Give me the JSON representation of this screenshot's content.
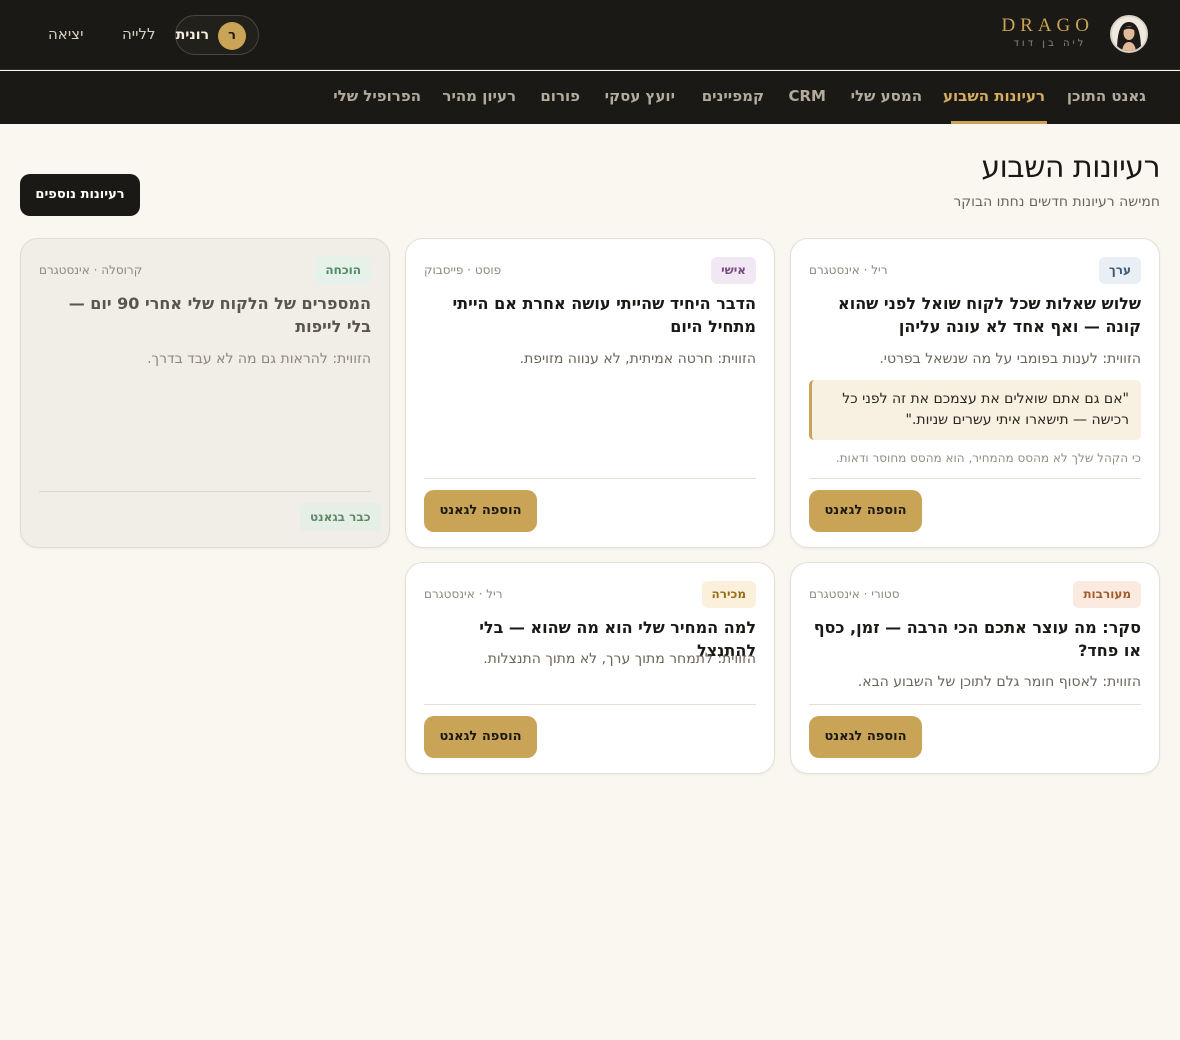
{
  "brand": {
    "name": "DRAGO",
    "subtitle": "ליה בן דוד"
  },
  "user": {
    "initial": "ר",
    "name": "רונית"
  },
  "topbar": {
    "night": "ללייה",
    "logout": "יציאה"
  },
  "nav": {
    "tabs": [
      {
        "label": "גאנט התוכן"
      },
      {
        "label": "רעיונות השבוע"
      },
      {
        "label": "המסע שלי"
      },
      {
        "label": "CRM"
      },
      {
        "label": "קמפיינים"
      },
      {
        "label": "יועץ עסקי"
      },
      {
        "label": "פורום"
      },
      {
        "label": "רעיון מהיר"
      },
      {
        "label": "הפרופיל שלי"
      }
    ],
    "active": "רעיונות השבוע"
  },
  "header": {
    "title": "רעיונות השבוע",
    "subtitle": "חמישה רעיונות חדשים נחתו הבוקר",
    "more_button": "רעיונות נוספים"
  },
  "cards": [
    {
      "tag": "ערך",
      "meta": "ריל · אינסטגרם",
      "title": "שלוש שאלות שכל לקוח שואל לפני שהוא קונה — ואף אחד לא עונה עליהן",
      "angle": "הזווית: לענות בפומבי על מה שנשאל בפרטי.",
      "quote": "\"אם גם אתם שואלים את עצמכם את זה לפני כל רכישה — תישארו איתי עשרים שניות.\"",
      "note": "כי הקהל שלך לא מהסס מהמחיר, הוא מהסס מחוסר ודאות.",
      "button": "הוספה לגאנט"
    },
    {
      "tag": "אישי",
      "meta": "פוסט · פייסבוק",
      "title": "הדבר היחיד שהייתי עושה אחרת אם הייתי מתחיל היום",
      "angle": "הזווית: חרטה אמיתית, לא ענווה מזויפת.",
      "button": "הוספה לגאנט"
    },
    {
      "tag": "הוכחה",
      "meta": "קרוסלה · אינסטגרם",
      "title": "המספרים של הלקוח שלי אחרי 90 יום — בלי לייפות",
      "angle": "הזווית: להראות גם מה לא עבד בדרך.",
      "status": "כבר בגאנט"
    },
    {
      "tag": "מעורבות",
      "meta": "סטורי · אינסטגרם",
      "title": "סקר: מה עוצר אתכם הכי הרבה — זמן, כסף או פחד?",
      "angle": "הזווית: לאסוף חומר גלם לתוכן של השבוע הבא.",
      "button": "הוספה לגאנט"
    },
    {
      "tag": "מכירה",
      "meta": "ריל · אינסטגרם",
      "title": "למה המחיר שלי הוא מה שהוא — בלי להתנצל",
      "angle": "הזווית: לתמחר מתוך ערך, לא מתוך התנצלות.",
      "button": "הוספה לגאנט"
    }
  ],
  "colors": {
    "background": "#faf7f1",
    "topbar": "#1b1915",
    "accent": "#c9a356",
    "tag_value_bg": "#e9eff4",
    "tag_value_fg": "#3c5a73",
    "tag_personal_bg": "#f1e8f3",
    "tag_personal_fg": "#7a4a86",
    "tag_proof_bg": "#e6f2e9",
    "tag_proof_fg": "#4f8a62",
    "tag_engage_bg": "#fbeadf",
    "tag_engage_fg": "#a45a2a",
    "tag_sale_bg": "#faf0dc",
    "tag_sale_fg": "#9a6c14"
  }
}
